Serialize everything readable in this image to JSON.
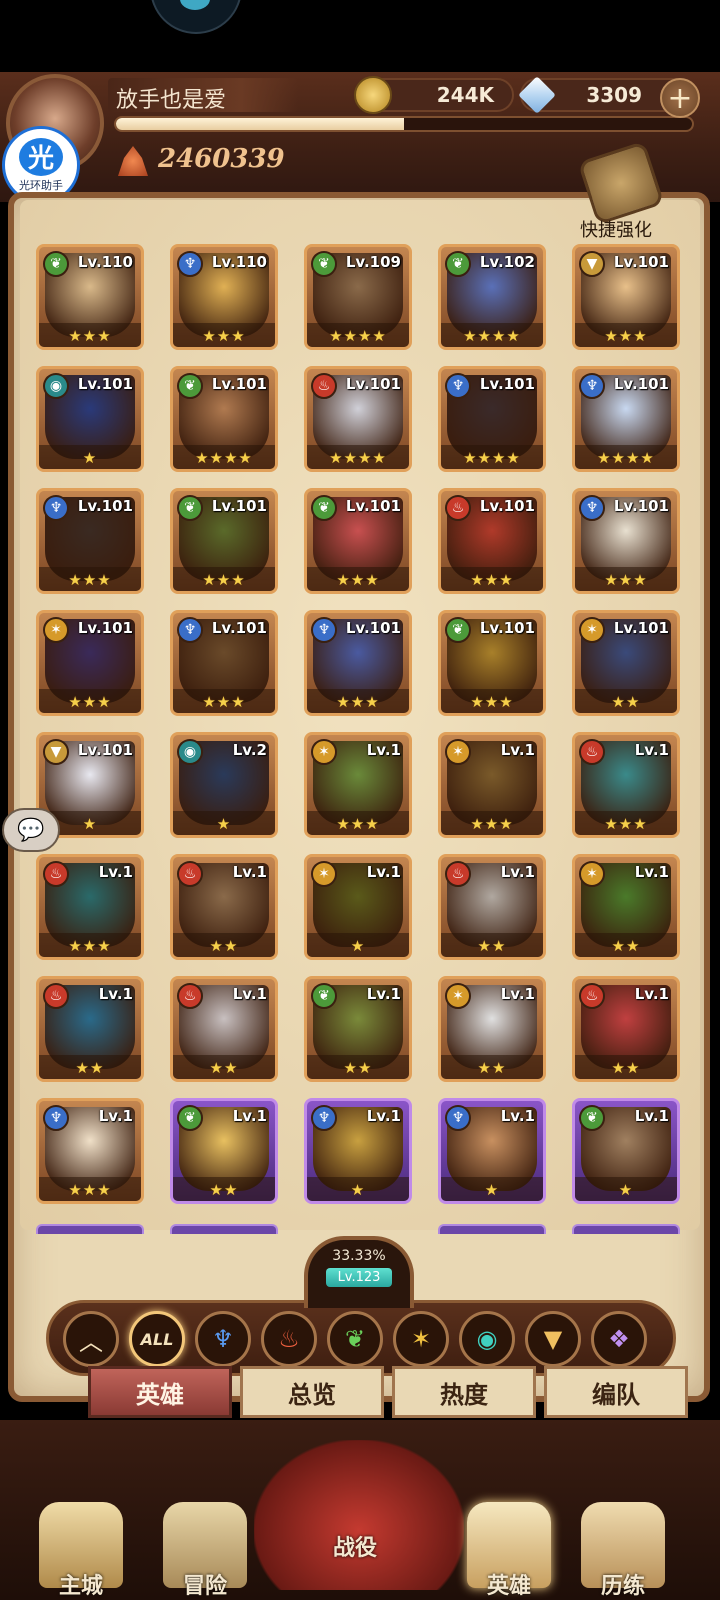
{
  "player": {
    "name": "放手也是爱",
    "power": "2460339",
    "xp_fraction": 0.5
  },
  "assistant_badge": {
    "glyph": "光",
    "label": "光环助手"
  },
  "currency": {
    "gold": "244K",
    "gems": "3309",
    "plus": "+"
  },
  "quick_upgrade": {
    "label": "快捷强化"
  },
  "faction_colors": {
    "verdant": "#4c9a3a",
    "water": "#3a6ec8",
    "fire": "#c83a2a",
    "light": "#d69a2a",
    "arcane": "#2a8a8a",
    "tri": "#c89a3a",
    "void": "#8a5ac8"
  },
  "heroes": [
    {
      "level": "Lv.110",
      "faction": "verdant",
      "stars": "★★★",
      "frame": "gold",
      "tone": "#d9b98a"
    },
    {
      "level": "Lv.110",
      "faction": "water",
      "stars": "★★★",
      "frame": "gold",
      "tone": "#e0b054"
    },
    {
      "level": "Lv.109",
      "faction": "verdant",
      "stars": "★★★★",
      "frame": "gold",
      "tone": "#8a6a4a"
    },
    {
      "level": "Lv.102",
      "faction": "verdant",
      "stars": "★★★★",
      "frame": "gold",
      "tone": "#5a70b8"
    },
    {
      "level": "Lv.101",
      "faction": "tri",
      "stars": "★★★",
      "frame": "gold",
      "tone": "#e8c08a"
    },
    {
      "level": "Lv.101",
      "faction": "arcane",
      "stars": "★",
      "frame": "gold",
      "tone": "#2a3a7a"
    },
    {
      "level": "Lv.101",
      "faction": "verdant",
      "stars": "★★★★",
      "frame": "gold",
      "tone": "#b07a50"
    },
    {
      "level": "Lv.101",
      "faction": "fire",
      "stars": "★★★★",
      "frame": "gold",
      "tone": "#d0d0d8"
    },
    {
      "level": "Lv.101",
      "faction": "water",
      "stars": "★★★★",
      "frame": "gold",
      "tone": "#3a2a2a"
    },
    {
      "level": "Lv.101",
      "faction": "water",
      "stars": "★★★★",
      "frame": "gold",
      "tone": "#c8d8f0"
    },
    {
      "level": "Lv.101",
      "faction": "water",
      "stars": "★★★",
      "frame": "gold",
      "tone": "#3a2a22"
    },
    {
      "level": "Lv.101",
      "faction": "verdant",
      "stars": "★★★",
      "frame": "gold",
      "tone": "#5a6a2a"
    },
    {
      "level": "Lv.101",
      "faction": "verdant",
      "stars": "★★★",
      "frame": "gold",
      "tone": "#c85050"
    },
    {
      "level": "Lv.101",
      "faction": "fire",
      "stars": "★★★",
      "frame": "gold",
      "tone": "#b03a2a"
    },
    {
      "level": "Lv.101",
      "faction": "water",
      "stars": "★★★",
      "frame": "gold",
      "tone": "#e8e0d0"
    },
    {
      "level": "Lv.101",
      "faction": "light",
      "stars": "★★★",
      "frame": "gold",
      "tone": "#3a2a5a"
    },
    {
      "level": "Lv.101",
      "faction": "water",
      "stars": "★★★",
      "frame": "gold",
      "tone": "#6a4a2a"
    },
    {
      "level": "Lv.101",
      "faction": "water",
      "stars": "★★★",
      "frame": "gold",
      "tone": "#4a5aa0"
    },
    {
      "level": "Lv.101",
      "faction": "verdant",
      "stars": "★★★",
      "frame": "gold",
      "tone": "#a8802a"
    },
    {
      "level": "Lv.101",
      "faction": "light",
      "stars": "★★",
      "frame": "gold",
      "tone": "#3a4a7a"
    },
    {
      "level": "Lv.101",
      "faction": "tri",
      "stars": "★",
      "frame": "gold",
      "tone": "#e8e8f0"
    },
    {
      "level": "Lv.2",
      "faction": "arcane",
      "stars": "★",
      "frame": "gold",
      "tone": "#2a3a5a"
    },
    {
      "level": "Lv.1",
      "faction": "light",
      "stars": "★★★",
      "frame": "gold",
      "tone": "#6a8a3a"
    },
    {
      "level": "Lv.1",
      "faction": "light",
      "stars": "★★★",
      "frame": "gold",
      "tone": "#7a5a2a"
    },
    {
      "level": "Lv.1",
      "faction": "fire",
      "stars": "★★★",
      "frame": "gold",
      "tone": "#3a8a8a"
    },
    {
      "level": "Lv.1",
      "faction": "fire",
      "stars": "★★★",
      "frame": "gold",
      "tone": "#2a6a6a"
    },
    {
      "level": "Lv.1",
      "faction": "fire",
      "stars": "★★",
      "frame": "gold",
      "tone": "#8a6a4a"
    },
    {
      "level": "Lv.1",
      "faction": "light",
      "stars": "★",
      "frame": "gold",
      "tone": "#5a5a1a"
    },
    {
      "level": "Lv.1",
      "faction": "fire",
      "stars": "★★",
      "frame": "gold",
      "tone": "#b0a8a0"
    },
    {
      "level": "Lv.1",
      "faction": "light",
      "stars": "★★",
      "frame": "gold",
      "tone": "#4a7a2a"
    },
    {
      "level": "Lv.1",
      "faction": "fire",
      "stars": "★★",
      "frame": "gold",
      "tone": "#2a6a8a"
    },
    {
      "level": "Lv.1",
      "faction": "fire",
      "stars": "★★",
      "frame": "gold",
      "tone": "#c8c0c0"
    },
    {
      "level": "Lv.1",
      "faction": "verdant",
      "stars": "★★",
      "frame": "gold",
      "tone": "#7a8a3a"
    },
    {
      "level": "Lv.1",
      "faction": "light",
      "stars": "★★",
      "frame": "gold",
      "tone": "#e0e0e0"
    },
    {
      "level": "Lv.1",
      "faction": "fire",
      "stars": "★★",
      "frame": "gold",
      "tone": "#c04040"
    },
    {
      "level": "Lv.1",
      "faction": "water",
      "stars": "★★★",
      "frame": "gold",
      "tone": "#f0e0c8"
    },
    {
      "level": "Lv.1",
      "faction": "verdant",
      "stars": "★★",
      "frame": "purple",
      "tone": "#e8c060"
    },
    {
      "level": "Lv.1",
      "faction": "water",
      "stars": "★",
      "frame": "purple",
      "tone": "#c8a040"
    },
    {
      "level": "Lv.1",
      "faction": "water",
      "stars": "★",
      "frame": "purple",
      "tone": "#c89060"
    },
    {
      "level": "Lv.1",
      "faction": "verdant",
      "stars": "★",
      "frame": "purple",
      "tone": "#a08060"
    }
  ],
  "roster_level": {
    "percent": "33.33%",
    "level": "Lv.123"
  },
  "faction_filters": [
    {
      "name": "collapse",
      "glyph": "︿",
      "color": "#f4e2bc"
    },
    {
      "name": "all",
      "glyph": "ALL",
      "color": "#f4e2bc"
    },
    {
      "name": "water",
      "glyph": "♆",
      "color": "#5a9af0"
    },
    {
      "name": "fire",
      "glyph": "♨",
      "color": "#f06040"
    },
    {
      "name": "verdant",
      "glyph": "❦",
      "color": "#6ad05a"
    },
    {
      "name": "light",
      "glyph": "✶",
      "color": "#f0c040"
    },
    {
      "name": "arcane",
      "glyph": "◉",
      "color": "#40d0c0"
    },
    {
      "name": "tri",
      "glyph": "▼",
      "color": "#f0c060"
    },
    {
      "name": "void",
      "glyph": "❖",
      "color": "#c090f0"
    }
  ],
  "tabs": [
    "英雄",
    "总览",
    "热度",
    "编队"
  ],
  "nav": [
    "主城",
    "冒险",
    "战役",
    "英雄",
    "历练"
  ]
}
